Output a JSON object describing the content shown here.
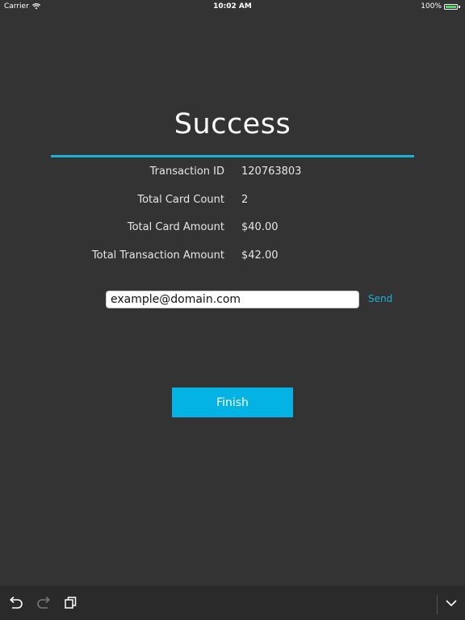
{
  "status_bar": {
    "carrier": "Carrier",
    "time": "10:02 AM",
    "battery_percent": "100%",
    "battery_level": 1.0,
    "battery_color": "#4cd964"
  },
  "screen": {
    "title": "Success",
    "accent_color": "#1ab0d8"
  },
  "details": [
    {
      "label": "Transaction ID",
      "value": "120763803"
    },
    {
      "label": "Total Card Count",
      "value": "2"
    },
    {
      "label": "Total Card Amount",
      "value": "$40.00"
    },
    {
      "label": "Total Transaction Amount",
      "value": "$42.00"
    }
  ],
  "email": {
    "value": "example@domain.com",
    "send_label": "Send"
  },
  "finish": {
    "label": "Finish",
    "color": "#03b3e3"
  },
  "toolbar": {
    "icons": [
      "undo-icon",
      "redo-icon",
      "copy-icon",
      "chevron-down-icon"
    ]
  }
}
